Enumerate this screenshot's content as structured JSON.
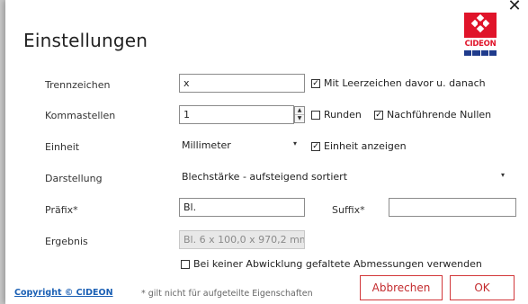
{
  "dialog": {
    "title": "Einstellungen",
    "close_glyph": "✕",
    "logo_text": "CIDEON"
  },
  "fields": {
    "separator": {
      "label": "Trennzeichen",
      "value": "x",
      "option_label": "Mit Leerzeichen davor u. danach",
      "option_checked": true
    },
    "decimals": {
      "label": "Kommastellen",
      "value": "1",
      "round_label": "Runden",
      "round_checked": false,
      "trailing_zeros_label": "Nachführende Nullen",
      "trailing_zeros_checked": true
    },
    "unit": {
      "label": "Einheit",
      "value": "Millimeter",
      "show_label": "Einheit anzeigen",
      "show_checked": true
    },
    "display": {
      "label": "Darstellung",
      "value": "Blechstärke - aufsteigend sortiert"
    },
    "prefix": {
      "label": "Präfix*",
      "value": "Bl."
    },
    "suffix": {
      "label": "Suffix*",
      "value": ""
    },
    "result": {
      "label": "Ergebnis",
      "value": "Bl. 6 x 100,0 x 970,2 mm"
    },
    "no_unfold": {
      "label": "Bei keiner Abwicklung gefaltete Abmessungen verwenden",
      "checked": false
    }
  },
  "footer": {
    "copyright": "Copyright © CIDEON",
    "note": "* gilt nicht für aufgeteilte Eigenschaften",
    "cancel_label": "Abbrechen",
    "ok_label": "OK"
  },
  "glyphs": {
    "check": "✓",
    "up": "▲",
    "down": "▼",
    "dropdown": "▾"
  },
  "colors": {
    "accent": "#d2373a",
    "brand_red": "#e0142a",
    "brand_blue": "#1f3b8c",
    "link": "#1a5fb4"
  }
}
